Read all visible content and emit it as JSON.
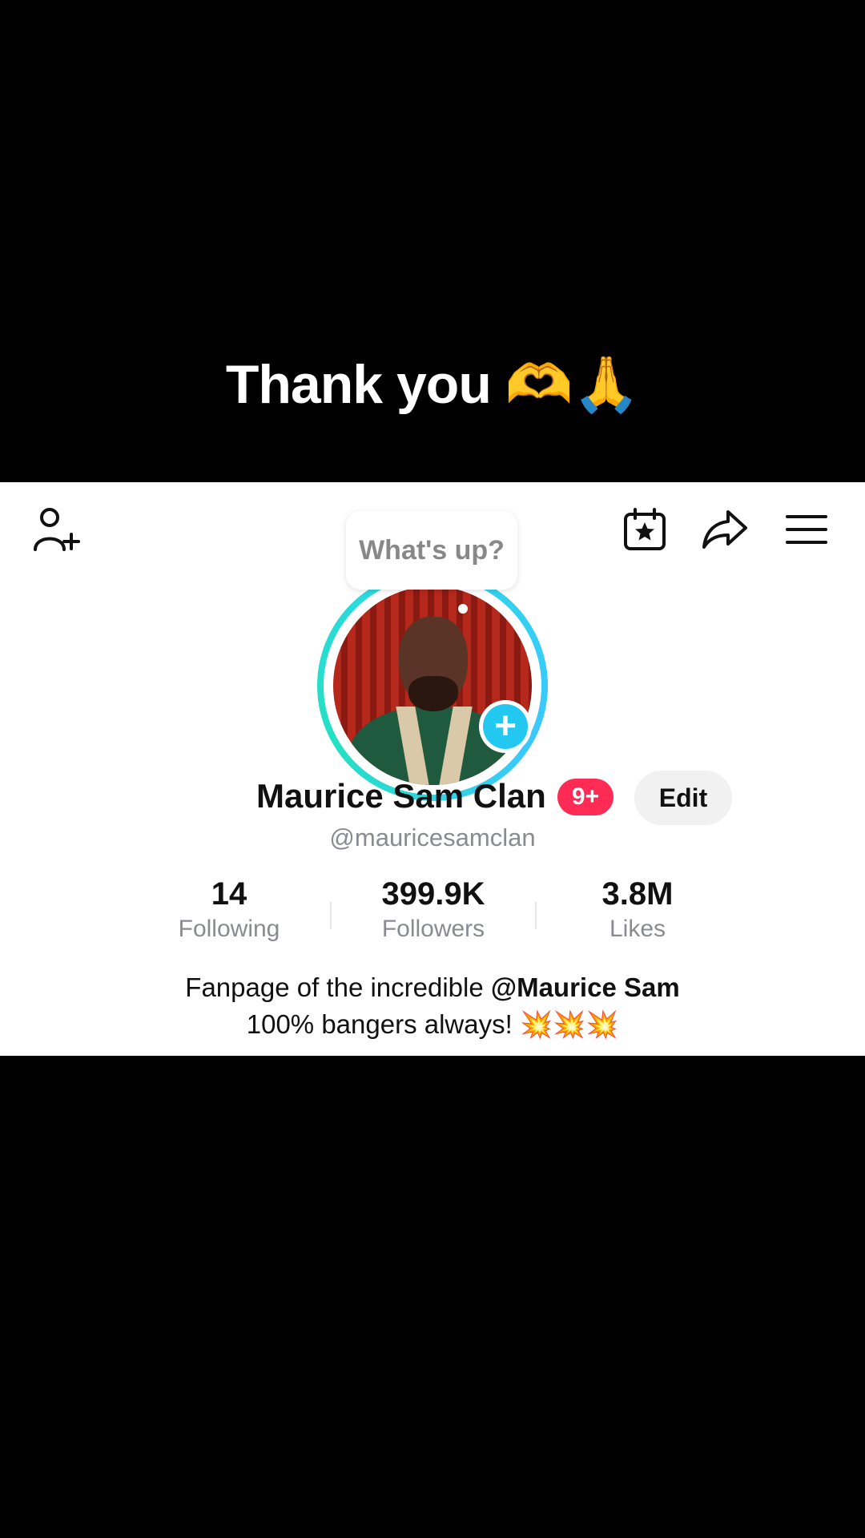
{
  "caption": {
    "text": "Thank you",
    "emojis": "🫶🙏"
  },
  "profile": {
    "bubble_text": "What's up?",
    "display_name": "Maurice Sam Clan",
    "notification_badge": "9+",
    "edit_label": "Edit",
    "handle": "@mauricesamclan",
    "stats": [
      {
        "value": "14",
        "label": "Following"
      },
      {
        "value": "399.9K",
        "label": "Followers"
      },
      {
        "value": "3.8M",
        "label": "Likes"
      }
    ],
    "bio": {
      "line1_prefix": "Fanpage of the incredible ",
      "line1_mention": "@Maurice Sam",
      "line2_text": "100% bangers always! ",
      "line2_emojis": "💥💥💥"
    }
  },
  "icons": {
    "top_left": "add-friend-icon",
    "top_right": [
      "calendar-star-icon",
      "share-icon",
      "menu-icon"
    ]
  },
  "colors": {
    "accent_badge": "#fe2c55",
    "plus_button": "#22c8f0",
    "ring": "#2fd6e8"
  }
}
